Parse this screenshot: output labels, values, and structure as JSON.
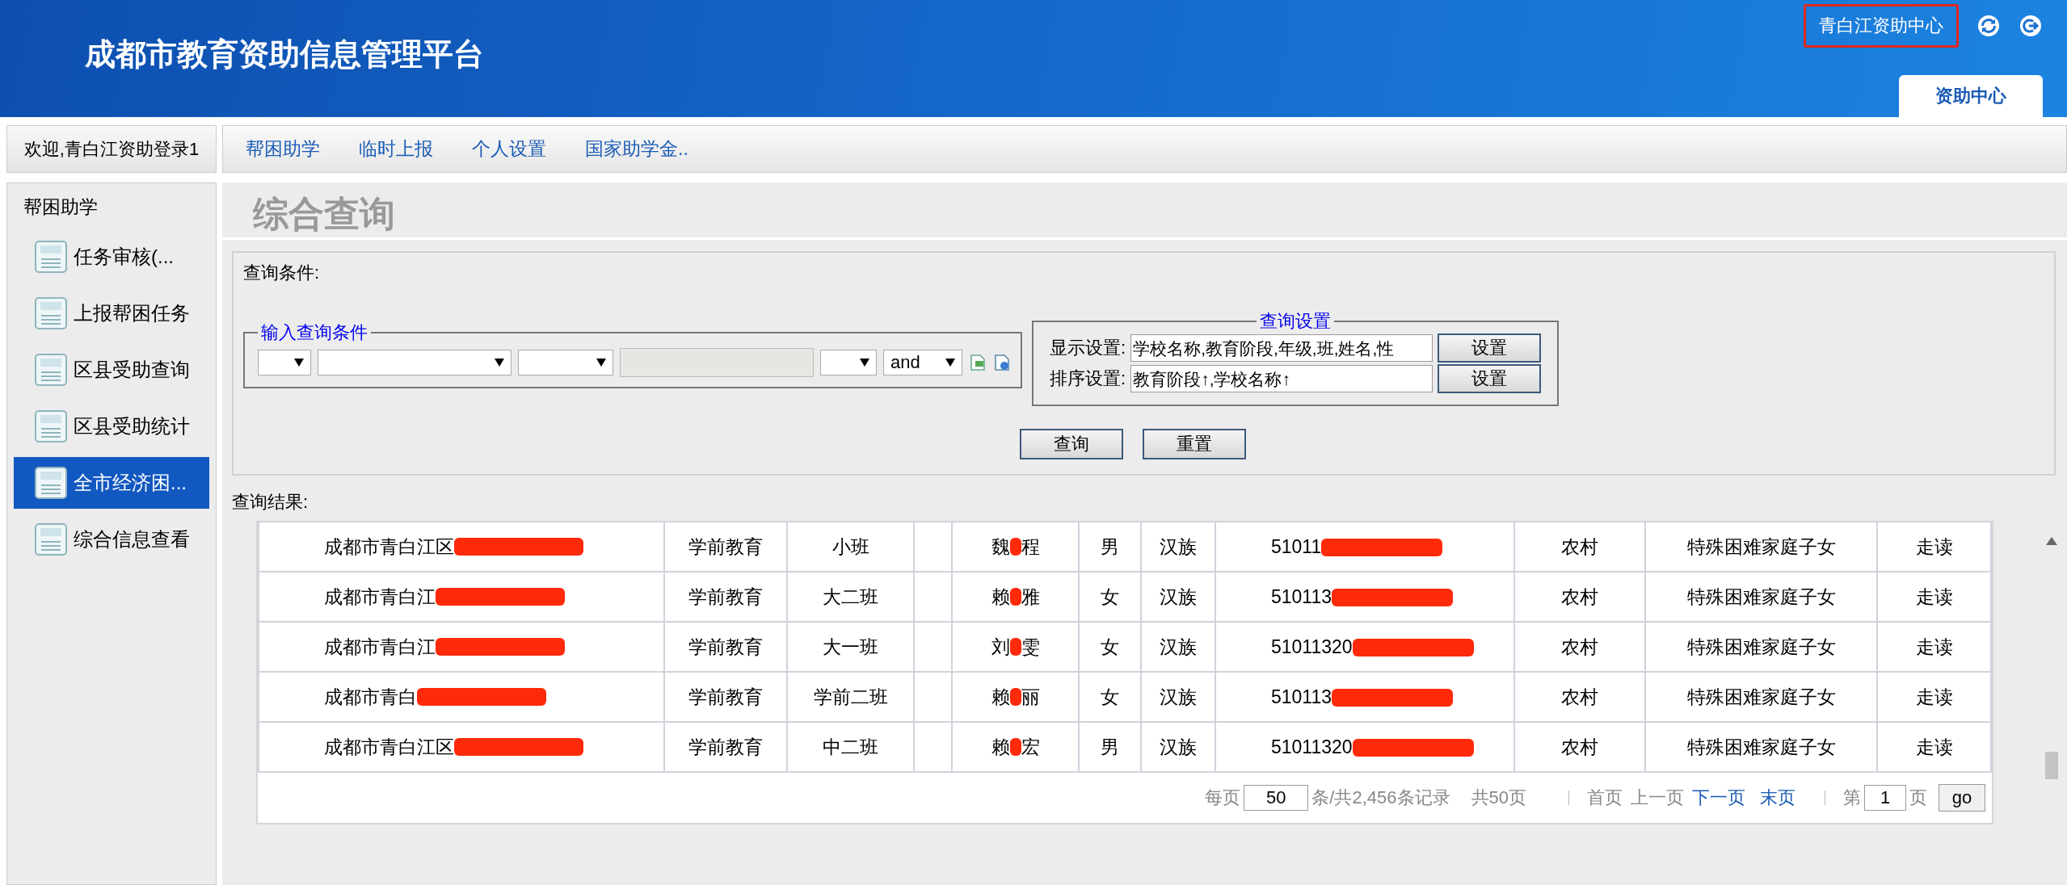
{
  "header": {
    "title": "成都市教育资助信息管理平台",
    "user_center": "青白江资助中心",
    "tab": {
      "label": "资助中心",
      "selected": true
    }
  },
  "welcome": "欢迎,青白江资助登录1",
  "nav": [
    {
      "label": "帮困助学"
    },
    {
      "label": "临时上报"
    },
    {
      "label": "个人设置"
    },
    {
      "label": "国家助学金.."
    }
  ],
  "sidebar": {
    "title": "帮困助学",
    "items": [
      {
        "label": "任务审核(...",
        "selected": false
      },
      {
        "label": "上报帮困任务",
        "selected": false
      },
      {
        "label": "区县受助查询",
        "selected": false
      },
      {
        "label": "区县受助统计",
        "selected": false
      },
      {
        "label": "全市经济困...",
        "selected": true
      },
      {
        "label": "综合信息查看",
        "selected": false
      }
    ]
  },
  "page_title": "综合查询",
  "query": {
    "label": "查询条件:",
    "conditions_legend": "输入查询条件",
    "logic_select": "and",
    "settings_legend": "查询设置",
    "settings": [
      {
        "label": "显示设置:",
        "value": "学校名称,教育阶段,年级,班,姓名,性",
        "button": "设置"
      },
      {
        "label": "排序设置:",
        "value": "教育阶段↑,学校名称↑",
        "button": "设置"
      }
    ],
    "buttons": [
      "查询",
      "重置"
    ]
  },
  "results_label": "查询结果:",
  "table": {
    "rows": [
      {
        "school": "成都市青白江区",
        "stage": "学前教育",
        "class": "小班",
        "name_first": "魏",
        "name_last": "程",
        "sex": "男",
        "ethnicity": "汉族",
        "id": "51011",
        "area": "农村",
        "category": "特殊困难家庭子女",
        "lodging": "走读"
      },
      {
        "school": "成都市青白江",
        "stage": "学前教育",
        "class": "大二班",
        "name_first": "赖",
        "name_last": "雅",
        "sex": "女",
        "ethnicity": "汉族",
        "id": "510113",
        "area": "农村",
        "category": "特殊困难家庭子女",
        "lodging": "走读"
      },
      {
        "school": "成都市青白江",
        "stage": "学前教育",
        "class": "大一班",
        "name_first": "刘",
        "name_last": "雯",
        "sex": "女",
        "ethnicity": "汉族",
        "id": "51011320",
        "area": "农村",
        "category": "特殊困难家庭子女",
        "lodging": "走读"
      },
      {
        "school": "成都市青白",
        "stage": "学前教育",
        "class": "学前二班",
        "name_first": "赖",
        "name_last": "丽",
        "sex": "女",
        "ethnicity": "汉族",
        "id": "510113",
        "area": "农村",
        "category": "特殊困难家庭子女",
        "lodging": "走读"
      },
      {
        "school": "成都市青白江区",
        "stage": "学前教育",
        "class": "中二班",
        "name_first": "赖",
        "name_last": "宏",
        "sex": "男",
        "ethnicity": "汉族",
        "id": "51011320",
        "area": "农村",
        "category": "特殊困难家庭子女",
        "lodging": "走读"
      }
    ]
  },
  "pagination": {
    "per_page_label": "每页",
    "per_page": "50",
    "records": "条/共2,456条记录",
    "pages": "共50页",
    "links": [
      {
        "label": "首页",
        "disabled": true
      },
      {
        "label": "上一页",
        "disabled": true
      },
      {
        "label": "下一页",
        "disabled": false
      },
      {
        "label": "末页",
        "disabled": false
      }
    ],
    "page_prefix": "第",
    "page": "1",
    "page_suffix": "页",
    "go": "go"
  }
}
